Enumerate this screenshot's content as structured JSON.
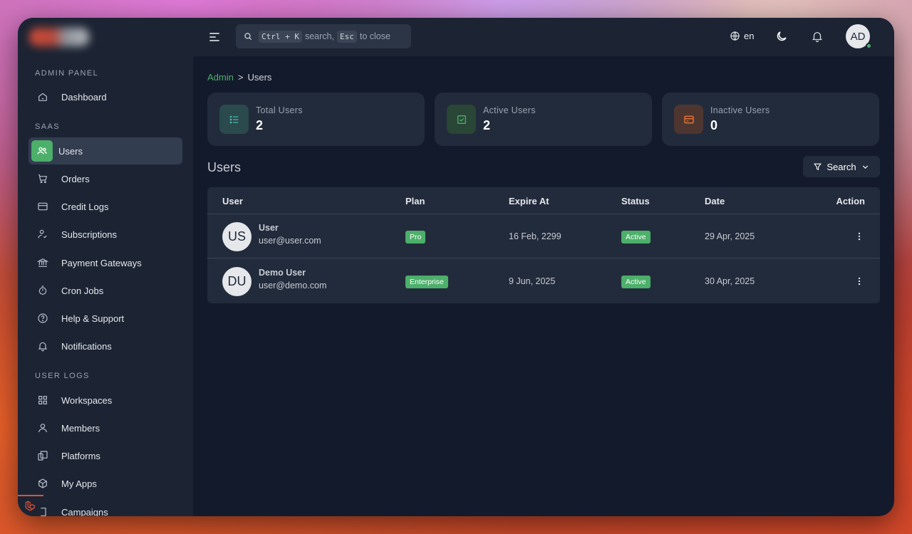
{
  "sidebar": {
    "sections": [
      {
        "label": "ADMIN PANEL"
      },
      {
        "label": "SAAS"
      },
      {
        "label": "USER LOGS"
      }
    ],
    "items": [
      {
        "label": "Dashboard",
        "icon": "home-icon"
      },
      {
        "label": "Users",
        "icon": "users-icon",
        "active": true
      },
      {
        "label": "Orders",
        "icon": "cart-icon"
      },
      {
        "label": "Credit Logs",
        "icon": "credit-card-icon"
      },
      {
        "label": "Subscriptions",
        "icon": "user-check-icon"
      },
      {
        "label": "Payment Gateways",
        "icon": "bank-icon"
      },
      {
        "label": "Cron Jobs",
        "icon": "stopwatch-icon"
      },
      {
        "label": "Help & Support",
        "icon": "help-circle-icon"
      },
      {
        "label": "Notifications",
        "icon": "bell-icon"
      },
      {
        "label": "Workspaces",
        "icon": "grid-icon"
      },
      {
        "label": "Members",
        "icon": "user-icon"
      },
      {
        "label": "Platforms",
        "icon": "platforms-icon"
      },
      {
        "label": "My Apps",
        "icon": "apps-icon"
      },
      {
        "label": "Campaigns",
        "icon": "campaign-icon"
      }
    ]
  },
  "topbar": {
    "search": {
      "shortcut_open": "Ctrl + K",
      "text_open": "search,",
      "shortcut_close": "Esc",
      "text_close": "to close"
    },
    "language": "en",
    "avatar_initials": "AD"
  },
  "breadcrumb": {
    "root": "Admin",
    "separator": ">",
    "current": "Users"
  },
  "stats": [
    {
      "label": "Total Users",
      "value": "2",
      "icon": "list-icon",
      "color": "#4ab8a8",
      "bg": "#2a4a4e"
    },
    {
      "label": "Active Users",
      "value": "2",
      "icon": "check-square-icon",
      "color": "#4caf6a",
      "bg": "#2a4636"
    },
    {
      "label": "Inactive Users",
      "value": "0",
      "icon": "credit-card-icon",
      "color": "#e8783a",
      "bg": "#4e3630"
    }
  ],
  "section_title": "Users",
  "search_button": "Search",
  "table": {
    "headers": {
      "user": "User",
      "plan": "Plan",
      "expire": "Expire At",
      "status": "Status",
      "date": "Date",
      "action": "Action"
    },
    "rows": [
      {
        "initials": "US",
        "name": "User",
        "email": "user@user.com",
        "plan": "Pro",
        "expire": "16 Feb, 2299",
        "status": "Active",
        "date": "29 Apr, 2025"
      },
      {
        "initials": "DU",
        "name": "Demo User",
        "email": "user@demo.com",
        "plan": "Enterprise",
        "expire": "9 Jun, 2025",
        "status": "Active",
        "date": "30 Apr, 2025"
      }
    ]
  },
  "colors": {
    "accent": "#4caf6a",
    "bg": "#131a2b",
    "panel": "#1c2434",
    "card": "#222b3b"
  }
}
